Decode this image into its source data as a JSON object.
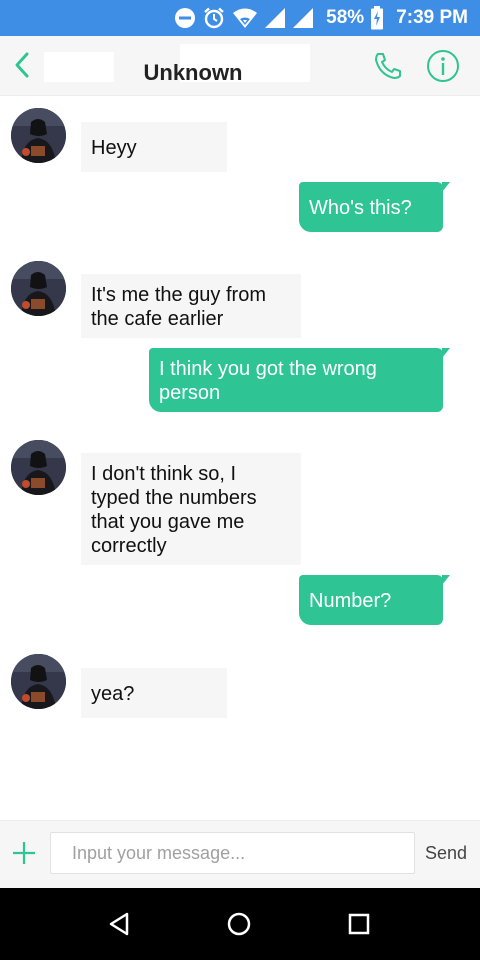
{
  "status_bar": {
    "battery_percent": "58%",
    "time": "7:39 PM",
    "icons": [
      "do-not-disturb-icon",
      "alarm-icon",
      "wifi-icon",
      "cell-signal-icon",
      "cell-signal-icon",
      "battery-charging-icon"
    ]
  },
  "header": {
    "title": "Unknown",
    "icons": [
      "back-arrow-icon",
      "phone-icon",
      "info-icon"
    ],
    "accent_color": "#2ec493"
  },
  "messages": [
    {
      "from": "them",
      "text": "Heyy"
    },
    {
      "from": "me",
      "text": "Who's this?"
    },
    {
      "from": "them",
      "lines": [
        "It's me the guy from",
        "the cafe earlier"
      ]
    },
    {
      "from": "me",
      "lines": [
        "I think you got the wrong",
        "person"
      ]
    },
    {
      "from": "them",
      "lines": [
        "I don't think so, I",
        "typed the numbers",
        "that you gave me",
        "correctly"
      ]
    },
    {
      "from": "me",
      "text": "Number?"
    },
    {
      "from": "them",
      "text": "yea?"
    }
  ],
  "input_bar": {
    "placeholder": "Input your message...",
    "send_label": "Send",
    "add_icon": "plus-icon"
  },
  "nav_bar": {
    "icons": [
      "back-triangle-icon",
      "home-circle-icon",
      "recents-square-icon"
    ]
  },
  "colors": {
    "status_bar": "#3f8ee6",
    "outgoing_bubble": "#2ec493",
    "incoming_bubble": "#f6f6f6"
  }
}
